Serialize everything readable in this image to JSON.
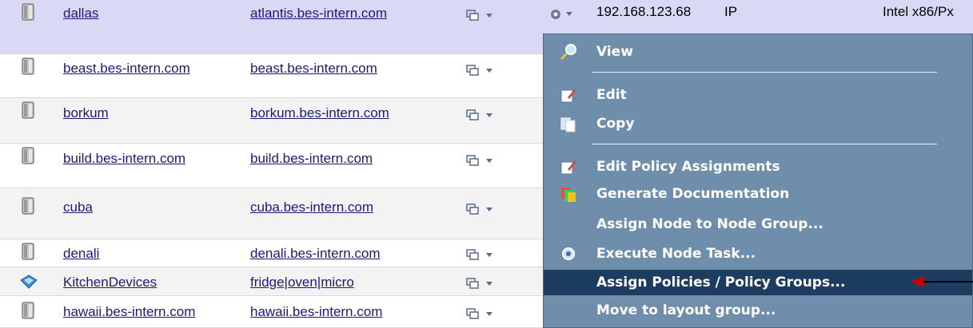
{
  "rows": [
    {
      "name": "dallas",
      "host": "atlantis.bes-intern.com",
      "ip": "192.168.123.68",
      "ip_label": "IP",
      "cpu": "Intel x86/Px"
    },
    {
      "name": "beast.bes-intern.com",
      "host": "beast.bes-intern.com"
    },
    {
      "name": "borkum",
      "host": "borkum.bes-intern.com"
    },
    {
      "name": "build.bes-intern.com",
      "host": "build.bes-intern.com"
    },
    {
      "name": "cuba",
      "host": "cuba.bes-intern.com"
    },
    {
      "name": "denali",
      "host": "denali.bes-intern.com"
    },
    {
      "name": "KitchenDevices",
      "host": "fridge|oven|micro"
    },
    {
      "name": "hawaii.bes-intern.com",
      "host": "hawaii.bes-intern.com"
    }
  ],
  "menu": {
    "items": [
      {
        "label": "View",
        "icon": "magnifier-icon"
      },
      {
        "label": "Edit",
        "icon": "edit-icon"
      },
      {
        "label": "Copy",
        "icon": "copy-icon"
      },
      {
        "label": "Edit Policy Assignments",
        "icon": "edit-policy-icon"
      },
      {
        "label": "Generate Documentation",
        "icon": "documentation-icon"
      },
      {
        "label": "Assign Node to Node Group..."
      },
      {
        "label": "Execute Node Task...",
        "icon": "task-icon"
      },
      {
        "label": "Assign Policies / Policy Groups...",
        "highlighted": true
      },
      {
        "label": "Move to layout group..."
      }
    ]
  },
  "colors": {
    "menu_bg": "#6f8eab",
    "menu_highlight": "#1c3d5f",
    "selected_row": "#d9d9f5",
    "link": "#1a1a7a",
    "arrow": "#cc0000"
  }
}
